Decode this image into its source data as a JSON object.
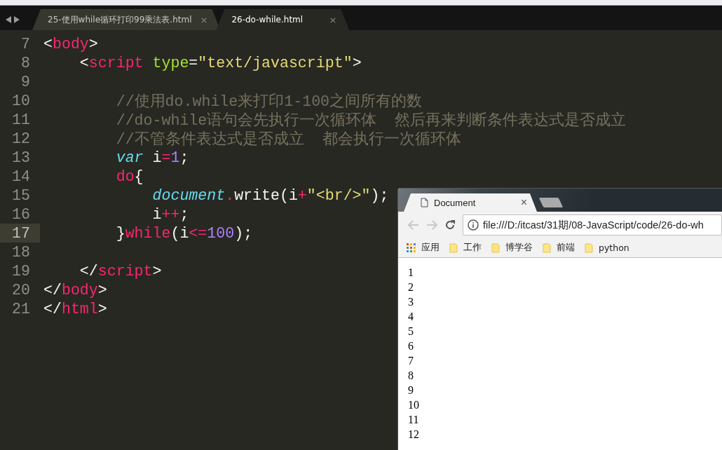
{
  "editor": {
    "tabs": [
      {
        "label": "25-使用while循环打印99乘法表.html",
        "close": "×",
        "selected": false
      },
      {
        "label": "26-do-while.html",
        "close": "×",
        "selected": true
      }
    ],
    "lines": [
      {
        "number": "7",
        "current": false,
        "tokens": [
          {
            "text": "<",
            "kind": "plain"
          },
          {
            "text": "body",
            "kind": "tag"
          },
          {
            "text": ">",
            "kind": "plain"
          }
        ]
      },
      {
        "number": "8",
        "current": false,
        "tokens": [
          {
            "text": "    <",
            "kind": "plain"
          },
          {
            "text": "script",
            "kind": "tag"
          },
          {
            "text": " type",
            "kind": "attr"
          },
          {
            "text": "=",
            "kind": "plain"
          },
          {
            "text": "\"text/javascript\"",
            "kind": "string"
          },
          {
            "text": ">",
            "kind": "plain"
          }
        ]
      },
      {
        "number": "9",
        "current": false
      },
      {
        "number": "10",
        "current": false,
        "tokens": [
          {
            "text": "        //使用do.while来打印1-100之间所有的数",
            "kind": "comment"
          }
        ]
      },
      {
        "number": "11",
        "current": false,
        "tokens": [
          {
            "text": "        //do-while语句会先执行一次循环体  然后再来判断条件表达式是否成立",
            "kind": "comment"
          }
        ]
      },
      {
        "number": "12",
        "current": false,
        "tokens": [
          {
            "text": "        //不管条件表达式是否成立  都会执行一次循环体",
            "kind": "comment"
          }
        ]
      },
      {
        "number": "13",
        "current": false,
        "tokens": [
          {
            "text": "        var",
            "kind": "storage"
          },
          {
            "text": " i",
            "kind": "plain"
          },
          {
            "text": "=",
            "kind": "operator"
          },
          {
            "text": "1",
            "kind": "number"
          },
          {
            "text": ";",
            "kind": "plain"
          }
        ]
      },
      {
        "number": "14",
        "current": false,
        "tokens": [
          {
            "text": "        do",
            "kind": "keyword"
          },
          {
            "text": "{",
            "kind": "plain"
          }
        ]
      },
      {
        "number": "15",
        "current": false,
        "tokens": [
          {
            "text": "            document",
            "kind": "storage"
          },
          {
            "text": ".",
            "kind": "operator"
          },
          {
            "text": "write(i",
            "kind": "plain"
          },
          {
            "text": "+",
            "kind": "operator"
          },
          {
            "text": "\"<br/>\"",
            "kind": "string"
          },
          {
            "text": ");",
            "kind": "plain"
          }
        ]
      },
      {
        "number": "16",
        "current": false,
        "tokens": [
          {
            "text": "            i",
            "kind": "plain"
          },
          {
            "text": "++",
            "kind": "operator"
          },
          {
            "text": ";",
            "kind": "plain"
          }
        ]
      },
      {
        "number": "17",
        "current": true,
        "tokens": [
          {
            "text": "        }",
            "kind": "plain"
          },
          {
            "text": "while",
            "kind": "keyword"
          },
          {
            "text": "(i",
            "kind": "plain"
          },
          {
            "text": "<=",
            "kind": "operator"
          },
          {
            "text": "100",
            "kind": "number"
          },
          {
            "text": ");",
            "kind": "plain"
          }
        ]
      },
      {
        "number": "18",
        "current": false
      },
      {
        "number": "19",
        "current": false,
        "tokens": [
          {
            "text": "    </",
            "kind": "plain"
          },
          {
            "text": "script",
            "kind": "tag"
          },
          {
            "text": ">",
            "kind": "plain"
          }
        ]
      },
      {
        "number": "20",
        "current": false,
        "tokens": [
          {
            "text": "</",
            "kind": "plain"
          },
          {
            "text": "body",
            "kind": "tag"
          },
          {
            "text": ">",
            "kind": "plain"
          }
        ]
      },
      {
        "number": "21",
        "current": false,
        "tokens": [
          {
            "text": "</",
            "kind": "plain"
          },
          {
            "text": "html",
            "kind": "tag"
          },
          {
            "text": ">",
            "kind": "plain"
          }
        ]
      }
    ]
  },
  "browser": {
    "tab": {
      "title": "Document",
      "close": "×"
    },
    "address": "file:///D:/itcast/31期/08-JavaScript/code/26-do-wh",
    "bookmarks": [
      {
        "kind": "apps",
        "label": "应用"
      },
      {
        "kind": "folder",
        "label": "工作"
      },
      {
        "kind": "folder",
        "label": "博学谷"
      },
      {
        "kind": "folder",
        "label": "前端"
      },
      {
        "kind": "folder",
        "label": "python"
      }
    ],
    "output": [
      "1",
      "2",
      "3",
      "4",
      "5",
      "6",
      "7",
      "8",
      "9",
      "10",
      "11",
      "12"
    ]
  }
}
